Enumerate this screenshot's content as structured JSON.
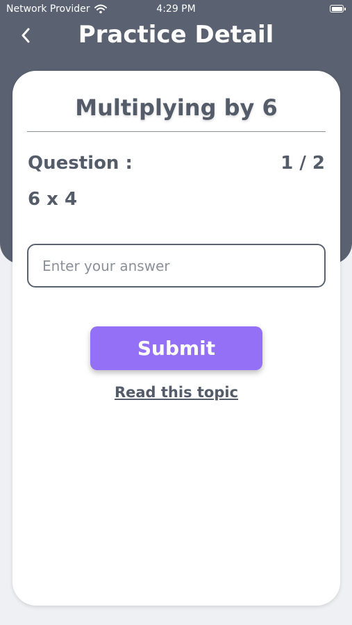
{
  "status_bar": {
    "carrier": "Network Provider",
    "time": "4:29 PM"
  },
  "header": {
    "title": "Practice Detail"
  },
  "card": {
    "topic_title": "Multiplying by 6",
    "question_label": "Question :",
    "question_count": "1 / 2",
    "question_text": "6 x 4",
    "answer_placeholder": "Enter your answer",
    "answer_value": "",
    "submit_label": "Submit",
    "read_topic_label": "Read this topic"
  },
  "colors": {
    "header_bg": "#5a6170",
    "text": "#545b69",
    "accent": "#9370f5",
    "page_bg": "#eef0f4"
  }
}
